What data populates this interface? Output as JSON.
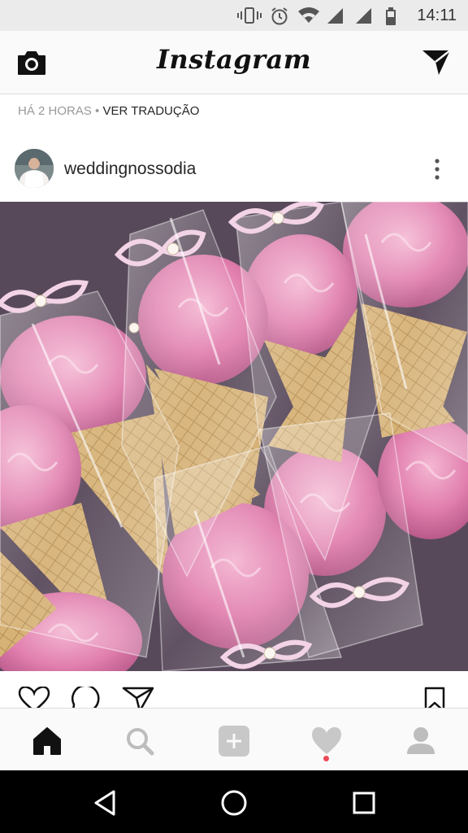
{
  "status_bar": {
    "time": "14:11",
    "icons": [
      "vibrate-icon",
      "alarm-icon",
      "wifi-icon",
      "signal-icon",
      "signal-icon",
      "battery-icon"
    ]
  },
  "header": {
    "app_title": "Instagram",
    "left_icon": "camera-icon",
    "right_icon": "direct-message-icon"
  },
  "meta": {
    "time_ago": "HÁ 2 HORAS",
    "separator": " • ",
    "translate_link": "VER TRADUÇÃO"
  },
  "post": {
    "username": "weddingnossodia",
    "more_icon": "more-vertical-icon",
    "photo_icon": "photo-image",
    "actions": [
      "heart-icon",
      "comment-icon",
      "share-icon",
      "bookmark-icon"
    ]
  },
  "bottom_nav": {
    "items": [
      "home-icon",
      "search-icon",
      "add-post-icon",
      "activity-icon",
      "profile-icon"
    ],
    "active": "home-icon",
    "badge_color": "#ed4956"
  },
  "system_nav": {
    "items": [
      "back-icon",
      "home-circle-icon",
      "recents-icon"
    ]
  },
  "colors": {
    "status_bar_bg": "#ebebeb",
    "header_bg": "#fafafa",
    "system_nav_bg": "#000000",
    "meringue_pink": "#e58ab5",
    "cone_tan": "#d9b87c"
  }
}
